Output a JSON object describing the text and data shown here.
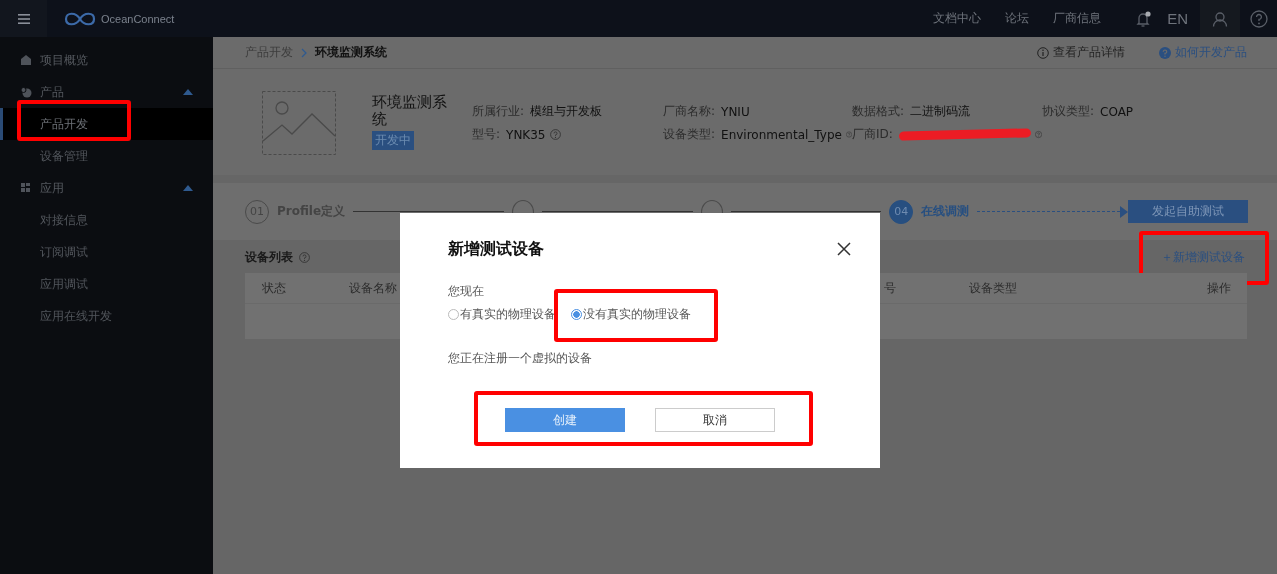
{
  "topbar": {
    "brand": "OceanConnect",
    "links": [
      "文档中心",
      "论坛",
      "厂商信息"
    ],
    "notification_dot": true,
    "language": "EN"
  },
  "sidebar": {
    "items": [
      {
        "label": "项目概览",
        "kind": "link"
      },
      {
        "label": "产品",
        "kind": "group",
        "expanded": true,
        "children": [
          {
            "label": "产品开发",
            "selected": true,
            "highlighted": true
          },
          {
            "label": "设备管理",
            "selected": false,
            "highlighted": false
          }
        ]
      },
      {
        "label": "应用",
        "kind": "group",
        "expanded": true,
        "children": [
          {
            "label": "对接信息",
            "selected": false,
            "highlighted": false
          },
          {
            "label": "订阅调试",
            "selected": false,
            "highlighted": false
          },
          {
            "label": "应用调试",
            "selected": false,
            "highlighted": false
          },
          {
            "label": "应用在线开发",
            "selected": false,
            "highlighted": false
          }
        ]
      }
    ]
  },
  "breadcrumb": [
    "产品开发",
    "环境监测系统"
  ],
  "header_links": [
    {
      "label": "查看产品详情",
      "kind": "info"
    },
    {
      "label": "如何开发产品",
      "kind": "help"
    }
  ],
  "product": {
    "name": "环境监测系统",
    "status": "开发中",
    "fields": [
      {
        "label": "所属行业:",
        "value": "模组与开发板"
      },
      {
        "label": "厂商名称:",
        "value": "YNIU"
      },
      {
        "label": "数据格式:",
        "value": "二进制码流"
      },
      {
        "label": "协议类型:",
        "value": "COAP"
      },
      {
        "label": "型号:",
        "value": "YNK35",
        "help": true
      },
      {
        "label": "设备类型:",
        "value": "Environmental_Type",
        "help": true
      },
      {
        "label": "厂商ID:",
        "redacted": true,
        "help": true
      }
    ]
  },
  "steps": [
    {
      "number": "01",
      "label": "Profile定义",
      "selected": false
    },
    {
      "kind": "covered",
      "selected": false
    },
    {
      "kind": "covered",
      "selected": false
    },
    {
      "number": "04",
      "label": "在线调测",
      "selected": true
    }
  ],
  "step_button": "发起自助测试",
  "device_list": {
    "title": "设备列表",
    "add_button": {
      "label": "＋新增测试设备",
      "highlighted": true
    },
    "columns": [
      "状态",
      "设备名称",
      "号",
      "设备类型",
      "操作"
    ]
  },
  "dialog": {
    "title": "新增测试设备",
    "prompt": "您现在",
    "options": [
      {
        "label": "有真实的物理设备",
        "selected": false
      },
      {
        "label": "没有真实的物理设备",
        "selected": true,
        "highlighted": true
      }
    ],
    "note": "您正在注册一个虚拟的设备",
    "buttons_highlighted": true,
    "buttons": [
      {
        "label": "创建",
        "kind": "primary"
      },
      {
        "label": "取消",
        "kind": "default"
      }
    ]
  }
}
